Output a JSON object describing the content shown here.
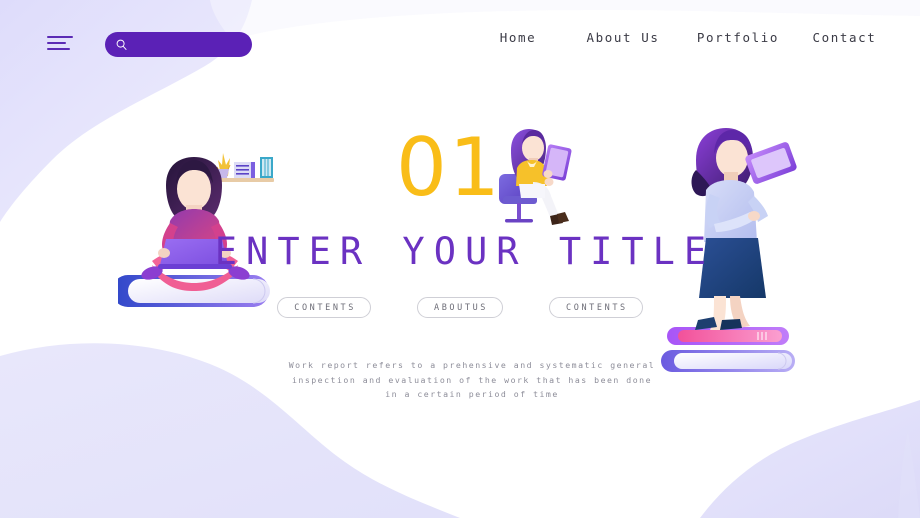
{
  "page": {
    "background_color": "#ffffff",
    "blob_color": "#e5e4fa"
  },
  "header": {
    "menu_icon": "hamburger-menu-icon",
    "menu_color": "#5b2bb5",
    "search": {
      "icon": "search-icon",
      "value": "",
      "placeholder": "",
      "background_color": "#5b21b6"
    },
    "nav": {
      "text_color": "#3b3b46",
      "items": [
        {
          "label": "Home"
        },
        {
          "label": "About Us"
        },
        {
          "label": "Portfolio"
        },
        {
          "label": "Contact"
        }
      ]
    }
  },
  "main": {
    "number": "01",
    "number_color": "#f9bd18",
    "title": "ENTER YOUR TITLE",
    "title_color": "#6b32c2",
    "pills": [
      {
        "label": "CONTENTS"
      },
      {
        "label": "ABOUTUS"
      },
      {
        "label": "CONTENTS"
      }
    ],
    "pill_text_color": "#6e6e78",
    "pill_border_color": "#cfcfd6",
    "body_text": "Work report refers to a  prehensive and systematic general inspection and evaluation of the work that has been done in a certain period of time",
    "body_text_color": "#8d8d99"
  },
  "illustrations": [
    {
      "name": "woman-with-laptop-on-book",
      "description": "Woman sitting cross-legged on a large book using a laptop, bookshelf with plant above",
      "colors": {
        "hair": "#3a2150",
        "shirt": "#b03a93",
        "laptop": "#8b5cf6",
        "legs": "#f4679a",
        "book": "#3f51d6"
      }
    },
    {
      "name": "woman-on-chair-with-tablet",
      "description": "Woman seated on a purple chair reading a tablet",
      "colors": {
        "hair": "#7c3aed",
        "shirt": "#f6c12a",
        "chair": "#6d5bd0",
        "tablet": "#a855f7"
      }
    },
    {
      "name": "woman-standing-on-books-with-tablet",
      "description": "Woman in navy skirt standing on a stack of two books holding a tablet",
      "colors": {
        "hair": "#6b2fb5",
        "top": "#c9d2f5",
        "skirt": "#1e3f7a",
        "tablet": "#b07cf0",
        "book_top": "#f472b6",
        "book_bottom": "#d9d7fa"
      }
    }
  ]
}
